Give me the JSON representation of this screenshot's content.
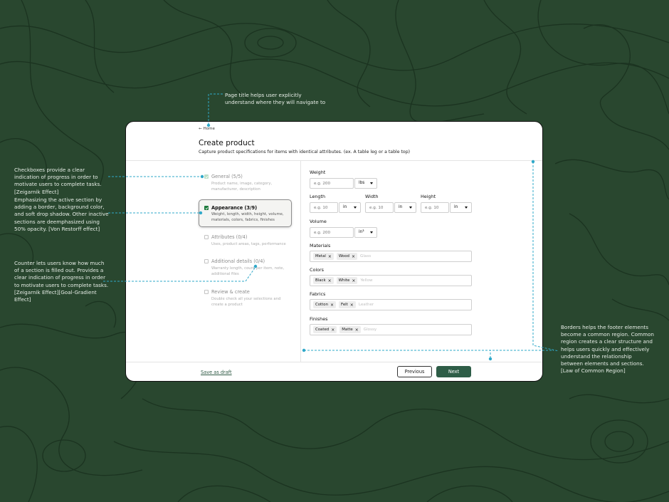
{
  "annotations": {
    "title_note": "Page title helps user explicitly understand where they will navigate to",
    "checkbox_note": "Checkboxes provide a clear indication of progress in order to motivate users to complete tasks. [Zeigarnik Effect]",
    "active_note": "Emphasizing the active section by adding a border, background color, and soft drop shadow. Other inactive sections are deemphasized using 50% opacity. [Von Restorff effect]",
    "counter_note": "Counter lets users know how much of a section is filled out. Provides a clear indication of progress in order to motivate users to complete tasks. [Zeigarnik Effect][Goal-Gradient Effect]",
    "border_note": "Borders helps the footer elements become a common region. Common region creates a clear structure and helps users quickly and effectively understand the relationship between elements and sections. [Law of Common Region]"
  },
  "colors": {
    "background": "#29472f",
    "accent": "#2e5d47",
    "annotation": "#2fa8c9",
    "check_green": "#1e7a3c"
  },
  "header": {
    "back_label": "Home",
    "title": "Create product",
    "subtitle": "Capture product specifications for items with identical attributes. (ex. A table leg or a table top)"
  },
  "steps": [
    {
      "title": "General (5/5)",
      "desc": [
        "Product name, image, category,",
        "manufacturer, description"
      ],
      "state": "done"
    },
    {
      "title": "Appearance (3/9)",
      "desc": [
        "Weight, length, width, height, volume,",
        "materials, colors, fabrics, finishes"
      ],
      "state": "active"
    },
    {
      "title": "Attributes (0/4)",
      "desc": [
        "Uses, product areas, tags, performance"
      ],
      "state": "inactive"
    },
    {
      "title": "Additional details (0/4)",
      "desc": [
        "Warranty length, count per item, note,",
        "additional files"
      ],
      "state": "inactive"
    },
    {
      "title": "Review & create",
      "desc": [
        "Double check all your selections and",
        "create a product"
      ],
      "state": "inactive"
    }
  ],
  "form": {
    "weight": {
      "label": "Weight",
      "placeholder": "e.g. 200",
      "unit": "lbs"
    },
    "length": {
      "label": "Length",
      "placeholder": "e.g. 10",
      "unit": "in"
    },
    "width": {
      "label": "Width",
      "placeholder": "e.g. 10",
      "unit": "in"
    },
    "height": {
      "label": "Height",
      "placeholder": "e.g. 10",
      "unit": "in"
    },
    "volume": {
      "label": "Volume",
      "placeholder": "e.g. 200",
      "unit": "in³"
    },
    "materials": {
      "label": "Materials",
      "tags": [
        "Metal",
        "Wood"
      ],
      "placeholder": "Glass"
    },
    "colors": {
      "label": "Colors",
      "tags": [
        "Black",
        "White"
      ],
      "placeholder": "Yellow"
    },
    "fabrics": {
      "label": "Fabrics",
      "tags": [
        "Cotton",
        "Felt"
      ],
      "placeholder": "Leather"
    },
    "finishes": {
      "label": "Finishes",
      "tags": [
        "Coated",
        "Matte"
      ],
      "placeholder": "Glossy"
    }
  },
  "footer": {
    "draft_label": "Save as draft",
    "prev_label": "Previous",
    "next_label": "Next"
  }
}
